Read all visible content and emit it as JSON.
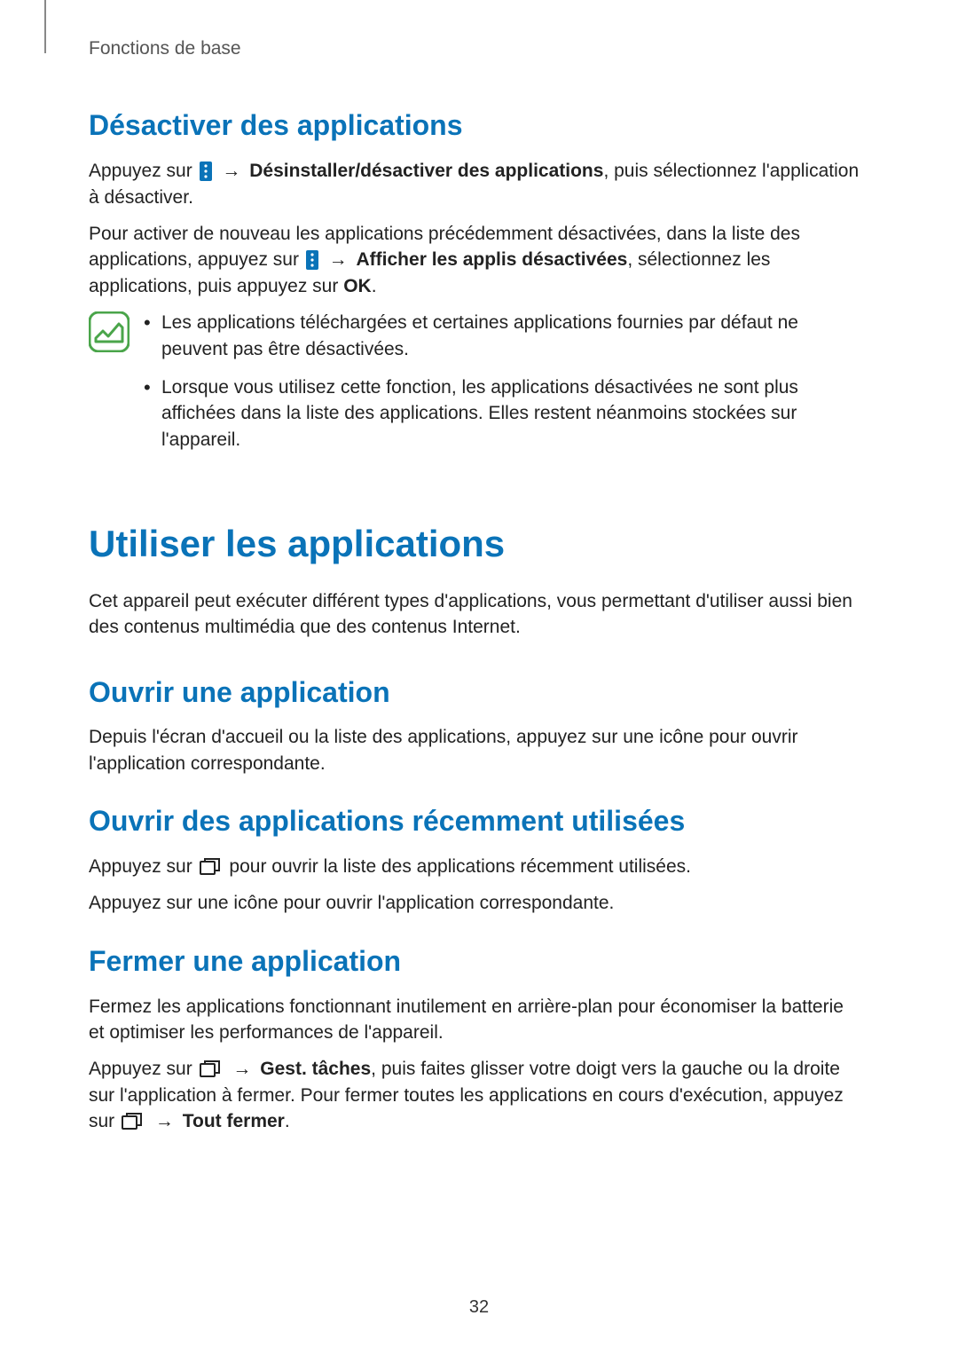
{
  "crumb": "Fonctions de base",
  "page_number": "32",
  "sections": {
    "s1": {
      "title": "Désactiver des applications",
      "p1_a": "Appuyez sur",
      "p1_b": "→",
      "p1_c": "Désinstaller/désactiver des applications",
      "p1_d": ", puis sélectionnez l'application à désactiver.",
      "p2_a": "Pour activer de nouveau les applications précédemment désactivées, dans la liste des applications, appuyez sur",
      "p2_b": "→",
      "p2_c": "Afficher les applis désactivées",
      "p2_d": ", sélectionnez les applications, puis appuyez sur",
      "p2_e": "OK",
      "p2_f": ".",
      "note1": "Les applications téléchargées et certaines applications fournies par défaut ne peuvent pas être désactivées.",
      "note2": "Lorsque vous utilisez cette fonction, les applications désactivées ne sont plus affichées dans la liste des applications. Elles restent néanmoins stockées sur l'appareil."
    },
    "h1": "Utiliser les applications",
    "h1_p": "Cet appareil peut exécuter différent types d'applications, vous permettant d'utiliser aussi bien des contenus multimédia que des contenus Internet.",
    "s2": {
      "title": "Ouvrir une application",
      "p1": "Depuis l'écran d'accueil ou la liste des applications, appuyez sur une icône pour ouvrir l'application correspondante."
    },
    "s3": {
      "title": "Ouvrir des applications récemment utilisées",
      "p1_a": "Appuyez sur",
      "p1_b": "pour ouvrir la liste des applications récemment utilisées.",
      "p2": "Appuyez sur une icône pour ouvrir l'application correspondante."
    },
    "s4": {
      "title": "Fermer une application",
      "p1": "Fermez les applications fonctionnant inutilement en arrière-plan pour économiser la batterie et optimiser les performances de l'appareil.",
      "p2_a": "Appuyez sur",
      "p2_b": "→",
      "p2_c": "Gest. tâches",
      "p2_d": ", puis faites glisser votre doigt vers la gauche ou la droite sur l'application à fermer. Pour fermer toutes les applications en cours d'exécution, appuyez sur",
      "p2_e": "→",
      "p2_f": "Tout fermer",
      "p2_g": "."
    }
  }
}
